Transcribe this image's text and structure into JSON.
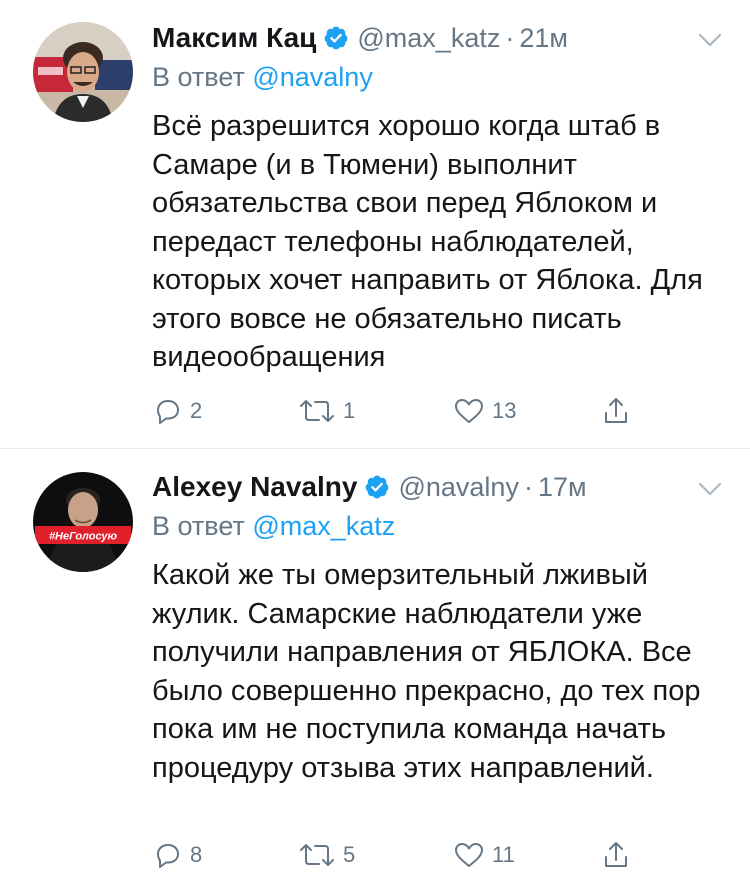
{
  "tweets": [
    {
      "author_name": "Максим Кац",
      "handle": "@max_katz",
      "dot": "·",
      "time": "21м",
      "reply_prefix": "В ответ",
      "reply_to": "@navalny",
      "text": "Всё разрешится хорошо когда штаб в Самаре (и в Тюмени) выполнит обязательства свои перед Яблоком и передаст телефоны наблюдателей, которых хочет направить от Яблока. Для этого вовсе не обязательно писать видеообращения",
      "replies": "2",
      "retweets": "1",
      "likes": "13"
    },
    {
      "author_name": "Alexey Navalny",
      "handle": "@navalny",
      "dot": "·",
      "time": "17м",
      "reply_prefix": "В ответ",
      "reply_to": "@max_katz",
      "avatar_badge": "#НеГолосую",
      "text": "Какой же ты омерзительный лживый жулик. Самарские наблюдатели уже получили направления от ЯБЛОКА. Все было совершенно прекрасно, до тех пор пока им не поступила команда начать процедуру отзыва этих направлений.",
      "replies": "8",
      "retweets": "5",
      "likes": "11"
    }
  ],
  "icons": {
    "verified": "verified-badge-icon",
    "more": "chevron-down-icon",
    "reply": "reply-icon",
    "retweet": "retweet-icon",
    "like": "heart-icon",
    "share": "share-icon"
  },
  "colors": {
    "text": "#14171a",
    "secondary": "#657786",
    "link": "#1da1f2",
    "verified": "#1da1f2",
    "divider": "#e6ecf0",
    "badge_red": "#e0202a"
  }
}
